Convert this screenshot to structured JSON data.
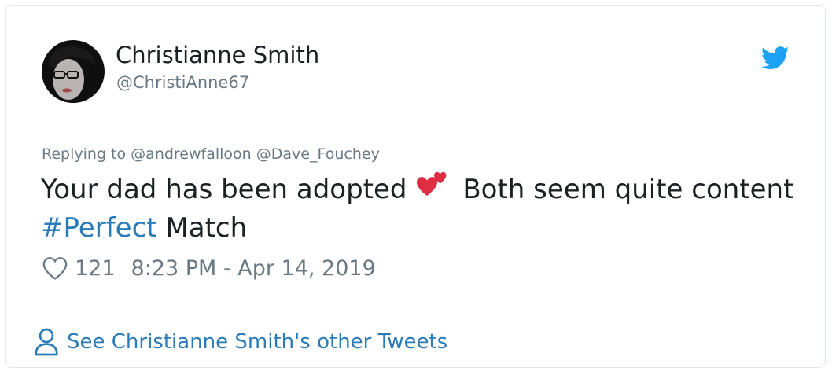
{
  "author": {
    "name": "Christianne Smith",
    "handle": "@ChristiAnne67"
  },
  "reply": {
    "prefix": "Replying to",
    "mentions": [
      "@andrewfalloon",
      "@Dave_Fouchey"
    ]
  },
  "tweet": {
    "text_part1": "Your dad has been adopted",
    "emoji": "two-hearts-emoji",
    "text_part2": " Both seem quite content ",
    "hashtag": "#Perfect",
    "text_part3": " Match"
  },
  "stats": {
    "likes": "121",
    "timestamp": "8:23 PM - Apr 14, 2019"
  },
  "footer": {
    "link_label": "See Christianne Smith's other Tweets"
  },
  "colors": {
    "link": "#2b7bb9",
    "muted": "#697882",
    "text": "#1c2022",
    "twitter_blue": "#1da1f2",
    "border": "#e1e8ed",
    "heart_red": "#dd2e44"
  },
  "icons": {
    "brand": "twitter-bird-icon",
    "like": "heart-outline-icon",
    "profile": "person-icon"
  }
}
